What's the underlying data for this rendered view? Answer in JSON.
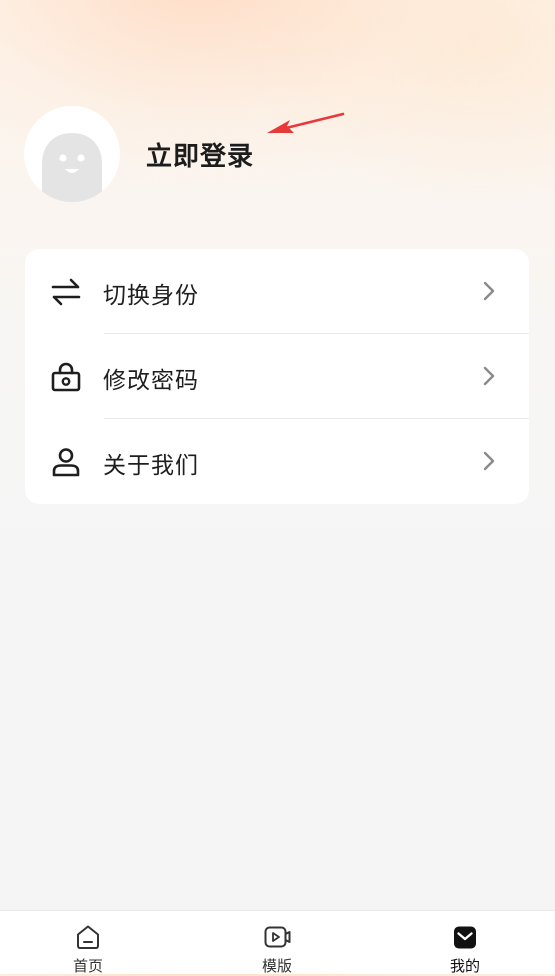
{
  "profile": {
    "login_label": "立即登录",
    "avatar_icon": "ghost-avatar-icon"
  },
  "menu": {
    "items": [
      {
        "label": "切换身份",
        "icon": "swap-arrows-icon"
      },
      {
        "label": "修改密码",
        "icon": "lock-icon"
      },
      {
        "label": "关于我们",
        "icon": "user-icon"
      }
    ],
    "chevron_icon": "chevron-right-icon"
  },
  "tabbar": {
    "tabs": [
      {
        "label": "首页",
        "icon": "home-icon",
        "active": false
      },
      {
        "label": "模版",
        "icon": "video-template-icon",
        "active": false
      },
      {
        "label": "我的",
        "icon": "mine-box-icon",
        "active": true
      }
    ]
  },
  "colors": {
    "text_primary": "#1e1e1e",
    "chevron": "#8a8a8a",
    "annotation_arrow": "#e8393a",
    "card_bg": "#ffffff",
    "page_bg": "#f5f5f5",
    "header_tint": "#fde8d6"
  }
}
